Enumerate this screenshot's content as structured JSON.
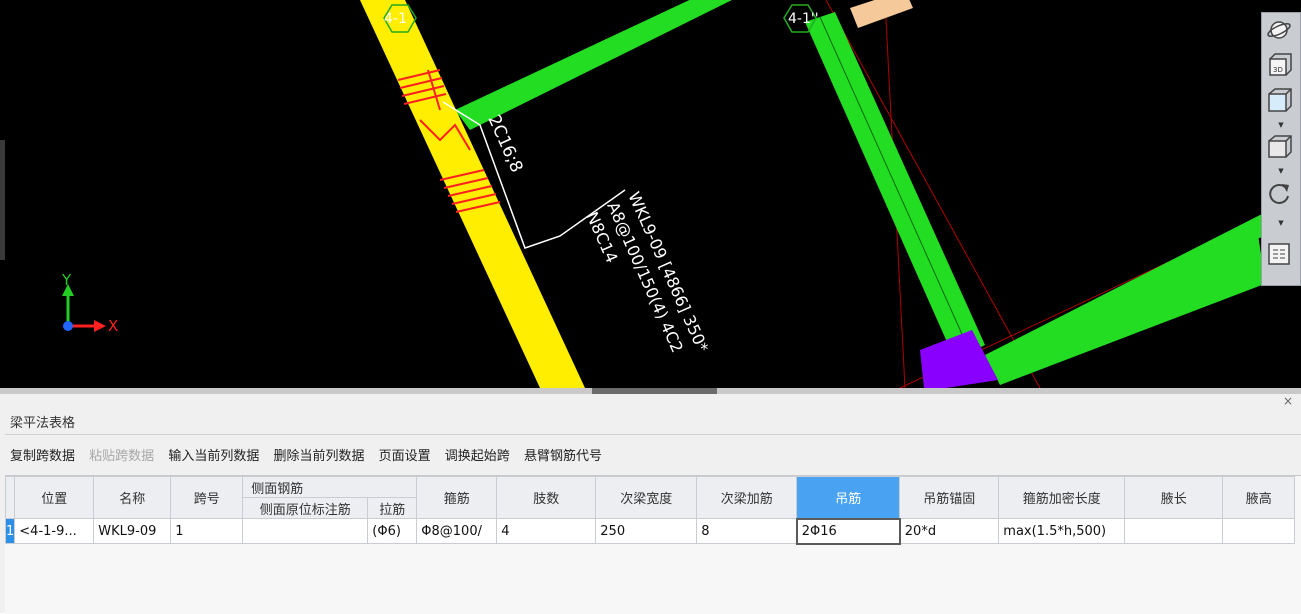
{
  "viewport": {
    "labels": {
      "axis_a": "4-1",
      "axis_b": "4-1''",
      "beam_side_annotation": "2C16;8",
      "beam_annotation_line1": "WKL9-09 [4866] 350*",
      "beam_annotation_line2": "A8@100/150(4) 4C2",
      "beam_annotation_line3": "N8C14",
      "axis_y": "Y",
      "axis_x": "X"
    },
    "colors": {
      "background": "#000000",
      "yellow_beam": "#ffee00",
      "green_beam": "#22dd22",
      "rebar": "#ff2020",
      "column": "#8a00ff",
      "peach_beam": "#f5c99a",
      "annotation": "#ffffff",
      "axis_line": "#b00000"
    },
    "view_toolbar": [
      "orbit-icon",
      "3d-view-icon",
      "box-view-icon",
      "cube-icon",
      "rotate-icon",
      "layer-list-icon"
    ]
  },
  "panel": {
    "title": "梁平法表格",
    "close": "×",
    "toolbar": [
      {
        "label": "复制跨数据",
        "enabled": true
      },
      {
        "label": "粘贴跨数据",
        "enabled": false
      },
      {
        "label": "输入当前列数据",
        "enabled": true
      },
      {
        "label": "删除当前列数据",
        "enabled": true
      },
      {
        "label": "页面设置",
        "enabled": true
      },
      {
        "label": "调换起始跨",
        "enabled": true
      },
      {
        "label": "悬臂钢筋代号",
        "enabled": true
      }
    ],
    "table": {
      "headers": {
        "position": "位置",
        "name": "名称",
        "span": "跨号",
        "side_group": "侧面钢筋",
        "side_original": "侧面原位标注筋",
        "tie": "拉筋",
        "stirrup": "箍筋",
        "legs": "肢数",
        "sec_width": "次梁宽度",
        "sec_add": "次梁加筋",
        "hanger": "吊筋",
        "hanger_anchor": "吊筋锚固",
        "dense_len": "箍筋加密长度",
        "haunch_len": "腋长",
        "haunch_h": "腋高"
      },
      "rows": [
        {
          "rownum": "1",
          "position": "<4-1-9...",
          "name": "WKL9-09",
          "span": "1",
          "side_original": "",
          "tie": "(Φ6)",
          "stirrup": "Φ8@100/",
          "legs": "4",
          "sec_width": "250",
          "sec_add": "8",
          "hanger": "2Φ16",
          "hanger_anchor": "20*d",
          "dense_len": "max(1.5*h,500)",
          "haunch_len": "",
          "haunch_h": ""
        }
      ],
      "active_column": "hanger"
    }
  }
}
